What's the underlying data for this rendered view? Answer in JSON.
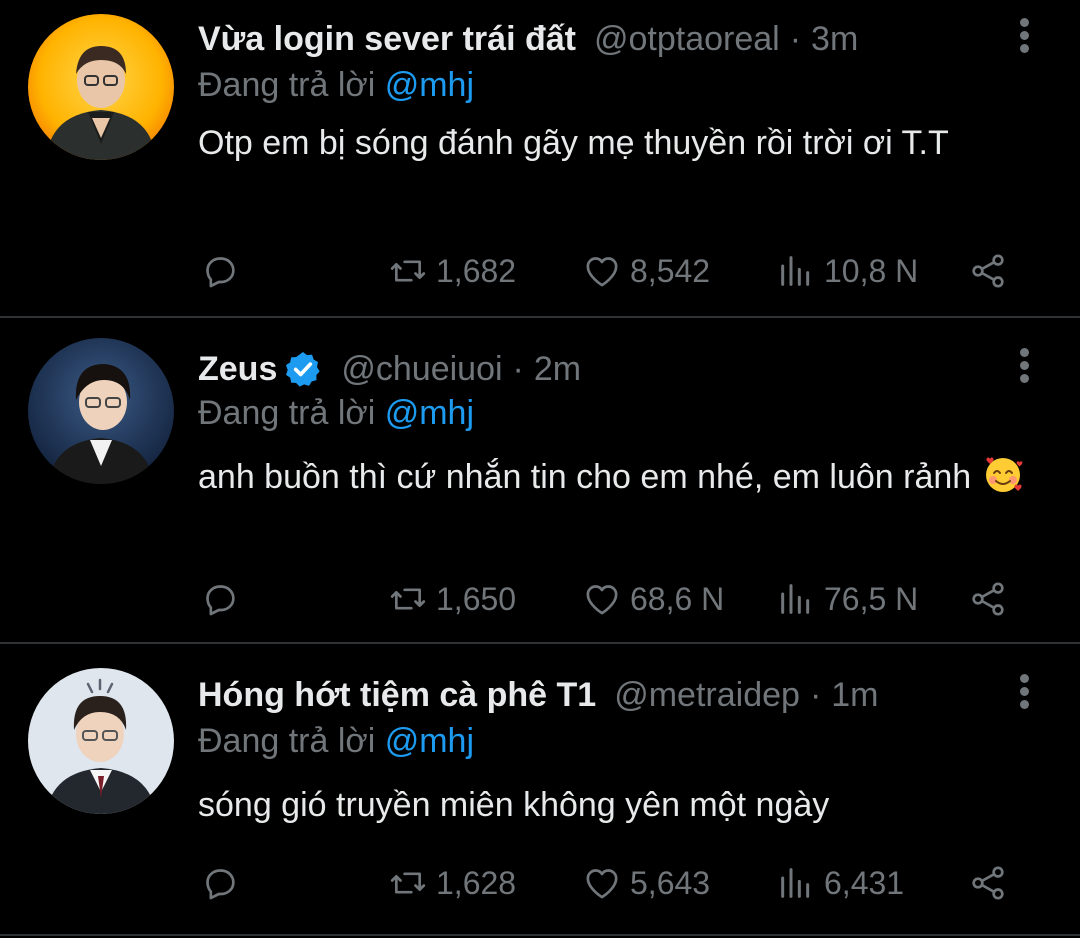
{
  "colors": {
    "background": "#000000",
    "primary_text": "#e7e9ea",
    "secondary_text": "#71767b",
    "accent": "#1d9bf0",
    "divider": "#2f3336"
  },
  "tweets": [
    {
      "display_name": "Vừa login sever trái đất",
      "verified": false,
      "handle": "@otptaoreal",
      "separator": "·",
      "time": "3m",
      "reply_prefix": "Đang trả lời",
      "reply_to": "@mhj",
      "text": "Otp em bị sóng đánh gãy mẹ thuyền rồi trời ơi T.T",
      "emoji": "",
      "retweets": "1,682",
      "likes": "8,542",
      "views": "10,8 N"
    },
    {
      "display_name": "Zeus",
      "verified": true,
      "handle": "@chueiuoi",
      "separator": "·",
      "time": "2m",
      "reply_prefix": "Đang trả lời",
      "reply_to": "@mhj",
      "text": "anh buồn thì cứ nhắn tin cho em nhé, em luôn rảnh",
      "emoji": "smiling-face-with-hearts-icon",
      "retweets": "1,650",
      "likes": "68,6 N",
      "views": "76,5 N"
    },
    {
      "display_name": "Hóng hớt tiệm cà phê T1",
      "verified": false,
      "handle": "@metraidep",
      "separator": "·",
      "time": "1m",
      "reply_prefix": "Đang trả lời",
      "reply_to": "@mhj",
      "text": "sóng gió truyền miên không yên một ngày",
      "emoji": "",
      "retweets": "1,628",
      "likes": "5,643",
      "views": "6,431"
    }
  ]
}
